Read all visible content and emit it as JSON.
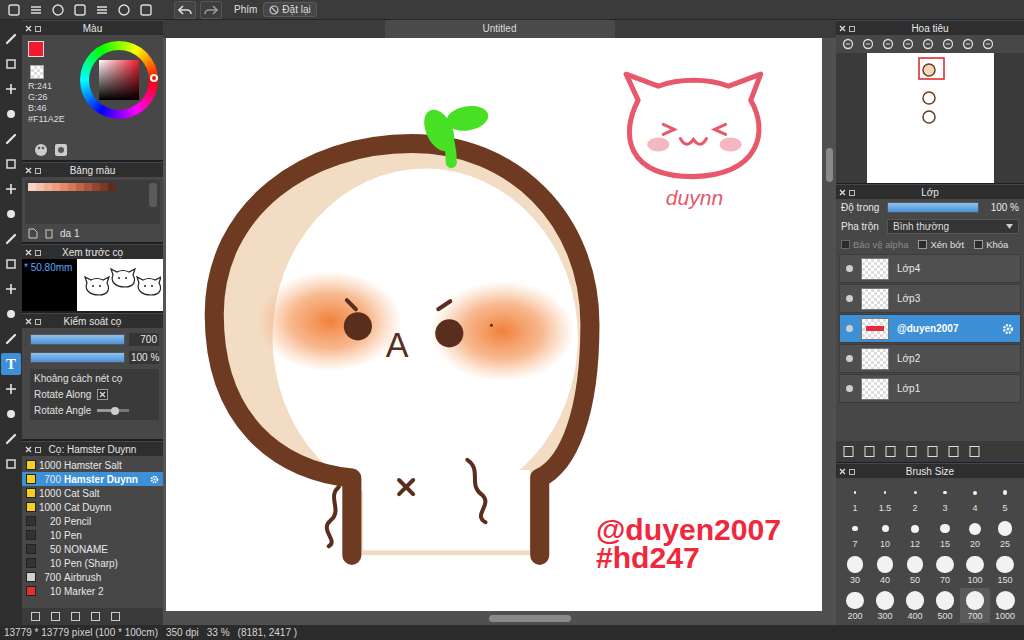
{
  "toolbar": {
    "shortcut_label": "Phím",
    "reset_button": "Đặt lại"
  },
  "tools": [
    {
      "label": "",
      "selected": false
    },
    {
      "label": "",
      "selected": false
    },
    {
      "label": "",
      "selected": false
    },
    {
      "label": "",
      "selected": false
    },
    {
      "label": "",
      "selected": false
    },
    {
      "label": "",
      "selected": false
    },
    {
      "label": "",
      "selected": false
    },
    {
      "label": "",
      "selected": false
    },
    {
      "label": "",
      "selected": false
    },
    {
      "label": "",
      "selected": false
    },
    {
      "label": "",
      "selected": false
    },
    {
      "label": "",
      "selected": false
    },
    {
      "label": "",
      "selected": false
    },
    {
      "label": "T",
      "selected": true
    },
    {
      "label": "",
      "selected": false
    },
    {
      "label": "",
      "selected": false
    },
    {
      "label": "",
      "selected": false
    },
    {
      "label": "",
      "selected": false
    }
  ],
  "color_panel": {
    "title": "Màu",
    "current_color": "#f11a2e",
    "r": "R:241",
    "g": "G:26",
    "b": "B:46",
    "hex": "#F11A2E"
  },
  "palette_panel": {
    "title": "Bảng màu",
    "name": "da 1",
    "swatches": [
      {
        "color": "#f8d3c4"
      },
      {
        "color": "#f5c0ac"
      },
      {
        "color": "#f1ad94"
      },
      {
        "color": "#ec9c80"
      },
      {
        "color": "#e38a6c"
      },
      {
        "color": "#d4775a"
      },
      {
        "color": "#c0654a"
      },
      {
        "color": "#a9543c"
      },
      {
        "color": "#8f4530"
      },
      {
        "color": "#7a3826"
      },
      {
        "color": "#622b1d"
      }
    ]
  },
  "brush_preview": {
    "title": "Xem trước cọ",
    "size": "* 50.80mm"
  },
  "brush_control": {
    "title": "Kiểm soát cọ",
    "size": {
      "value": "700",
      "level": 1
    },
    "opacity": {
      "value": "100 %",
      "level": 1
    },
    "options": [
      {
        "label": "Khoảng cách nét cọ",
        "kind": "label"
      },
      {
        "label": "Rotate Along",
        "kind": "checkbox",
        "checked": true
      },
      {
        "label": "Rotate Angle",
        "kind": "slider",
        "level": 0.55
      }
    ]
  },
  "brush_list": {
    "title": "Cọ: Hamster Duynn",
    "items": [
      {
        "size": "1000",
        "name": "Hamster Salt",
        "color": "#f5d020",
        "selected": false
      },
      {
        "size": "700",
        "name": "Hamster Duynn",
        "color": "#f5d020",
        "selected": true
      },
      {
        "size": "1000",
        "name": "Cat Salt",
        "color": "#f5d020",
        "selected": false
      },
      {
        "size": "1000",
        "name": "Cat Duynn",
        "color": "#f5d020",
        "selected": false
      },
      {
        "size": "20",
        "name": "Pencil",
        "color": "#333333",
        "selected": false
      },
      {
        "size": "10",
        "name": "Pen",
        "color": "#333333",
        "selected": false
      },
      {
        "size": "50",
        "name": "NONAME",
        "color": "#333333",
        "selected": false
      },
      {
        "size": "10",
        "name": "Pen (Sharp)",
        "color": "#333333",
        "selected": false
      },
      {
        "size": "700",
        "name": "Airbrush",
        "color": "#d0d0d0",
        "selected": false
      },
      {
        "size": "10",
        "name": "Marker 2",
        "color": "#e03030",
        "selected": false
      }
    ]
  },
  "canvas": {
    "tab": "Untitled",
    "mouth": "A",
    "watermark": [
      "@duyen2007",
      "#hd247"
    ],
    "signature": "duynn"
  },
  "navigator": {
    "title": "Hoa tiêu"
  },
  "layers": {
    "title": "Lớp",
    "opacity_label": "Độ trong",
    "opacity": {
      "value": "100 %",
      "level": 1
    },
    "blend_label": "Pha trộn",
    "blend_value": "Bình thường",
    "options": [
      {
        "label": "Bảo vệ alpha",
        "checked": false,
        "disabled": true
      },
      {
        "label": "Xén bớt",
        "checked": false,
        "disabled": false
      },
      {
        "label": "Khóa",
        "checked": false,
        "disabled": false
      }
    ],
    "items": [
      {
        "name": "Lớp4",
        "visible": true,
        "selected": false
      },
      {
        "name": "Lớp3",
        "visible": true,
        "selected": false
      },
      {
        "name": "@duyen2007",
        "visible": true,
        "selected": true
      },
      {
        "name": "Lớp2",
        "visible": true,
        "selected": false
      },
      {
        "name": "Lớp1",
        "visible": true,
        "selected": false
      }
    ]
  },
  "brush_size": {
    "title": "Brush Size",
    "items": [
      {
        "label": "1",
        "selected": false
      },
      {
        "label": "1.5",
        "selected": false
      },
      {
        "label": "2",
        "selected": false
      },
      {
        "label": "3",
        "selected": false
      },
      {
        "label": "4",
        "selected": false
      },
      {
        "label": "5",
        "selected": false
      },
      {
        "label": "7",
        "selected": false
      },
      {
        "label": "10",
        "selected": false
      },
      {
        "label": "12",
        "selected": false
      },
      {
        "label": "15",
        "selected": false
      },
      {
        "label": "20",
        "selected": false
      },
      {
        "label": "25",
        "selected": false
      },
      {
        "label": "30",
        "selected": false
      },
      {
        "label": "40",
        "selected": false
      },
      {
        "label": "50",
        "selected": false
      },
      {
        "label": "70",
        "selected": false
      },
      {
        "label": "100",
        "selected": false
      },
      {
        "label": "150",
        "selected": false
      },
      {
        "label": "200",
        "selected": false
      },
      {
        "label": "300",
        "selected": false
      },
      {
        "label": "400",
        "selected": false
      },
      {
        "label": "500",
        "selected": false
      },
      {
        "label": "700",
        "selected": true
      },
      {
        "label": "1000",
        "selected": false
      }
    ]
  },
  "status_bar": {
    "size": "13779 * 13779 pixel (100 * 100cm)",
    "dpi": "350 dpi",
    "zoom": "33 %",
    "cursor": "(8181, 2417 )"
  }
}
